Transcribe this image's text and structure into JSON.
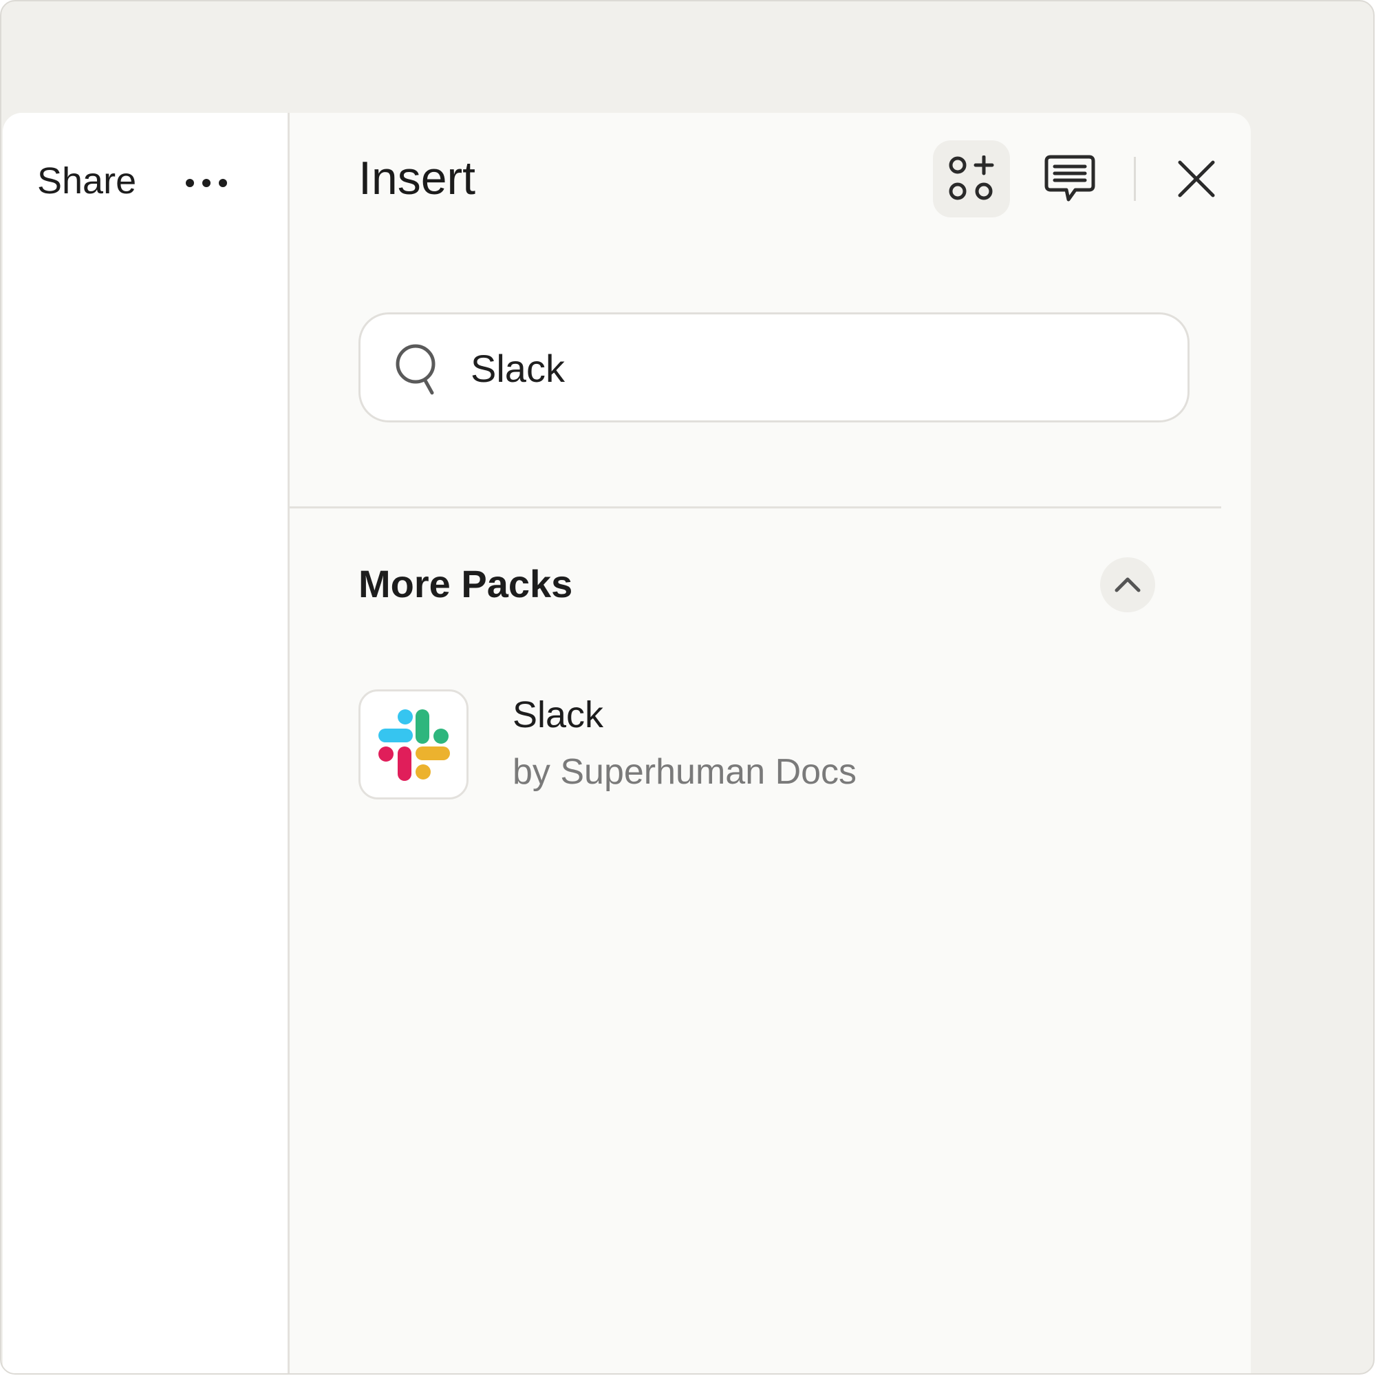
{
  "share_panel": {
    "share_label": "Share"
  },
  "insert_panel": {
    "title": "Insert",
    "search": {
      "value": "Slack"
    },
    "sections": {
      "more_packs": {
        "title": "More Packs",
        "items": [
          {
            "name": "Slack",
            "author": "by Superhuman Docs"
          }
        ]
      }
    }
  },
  "colors": {
    "slack_blue": "#36C5F0",
    "slack_green": "#2EB67D",
    "slack_red": "#E01E5A",
    "slack_yellow": "#ECB22E"
  },
  "icons": {
    "more": "more-horizontal-icon",
    "packs": "packs-grid-plus-icon",
    "comments": "comment-icon",
    "close": "close-icon",
    "search": "search-icon",
    "collapse": "chevron-up-icon",
    "pack_logo": "slack-logo-icon"
  }
}
